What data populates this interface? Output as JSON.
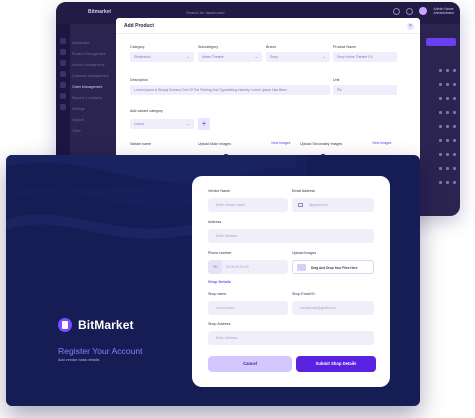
{
  "back": {
    "app_name": "Bitmarket",
    "search_placeholder": "Search for dashboard",
    "user_name": "Admin Name",
    "user_role": "Administrator",
    "nav_items": [
      "Dashboard",
      "Product Management",
      "Vendor Management",
      "Customer Management",
      "Order Management",
      "Reports & Analytics",
      "Settings",
      "Support",
      "Other"
    ],
    "add_button": "+ Add Product",
    "modal": {
      "title": "Add Product",
      "category_label": "Category",
      "category_value": "Electronics",
      "subcategory_label": "Subcategory",
      "subcategory_value": "Home Theatre",
      "brand_label": "Brand",
      "brand_value": "Sony",
      "product_name_label": "Product Name",
      "product_name_value": "Sony Home Theatre Ch",
      "description_label": "Description",
      "description_value": "Lorem Ipsum is Simply Dummy Text Of The Printing And Typesetting Industry. Lorem Ipsum Has Been",
      "unit_label": "Unit",
      "unit_value": "Pic",
      "variant_label": "Add variant category",
      "variant_value": "Colour",
      "variant_name_label": "Variant name",
      "main_images_label": "Upload Main Images",
      "view_images_1": "View Images",
      "secondary_images_label": "Upload Secondary Images",
      "view_images_2": "View Images"
    }
  },
  "front": {
    "brand": "BitMarket",
    "register_title": "Register Your Account",
    "register_subtitle": "Add vendor basic details",
    "form": {
      "vendor_name_label": "Vendor Name",
      "vendor_name_placeholder": "Enter vendor name",
      "email_label": "Email Address",
      "email_placeholder": "@gmail.com",
      "address_label": "Address",
      "address_placeholder": "Enter Address",
      "phone_label": "Phone number",
      "phone_code": "+91",
      "phone_placeholder": "00 00 00 00 00",
      "upload_label": "Upload Images",
      "upload_text": "Drag And Drop Your Files Here",
      "shop_details_label": "Shop Details",
      "shop_name_label": "Shop name",
      "shop_name_placeholder": "Lorem place",
      "shop_email_label": "Shop Email ID",
      "shop_email_placeholder": "samplemail@gmail.com",
      "shop_address_label": "Shop Address",
      "shop_address_placeholder": "Enter Address",
      "cancel_button": "Cancel",
      "submit_button": "Submit Shop Details"
    }
  },
  "colors": {
    "accent": "#5a21e0",
    "front_bg": "#161d55",
    "back_bg": "#2b2350",
    "title_purple": "#8f79ff"
  }
}
